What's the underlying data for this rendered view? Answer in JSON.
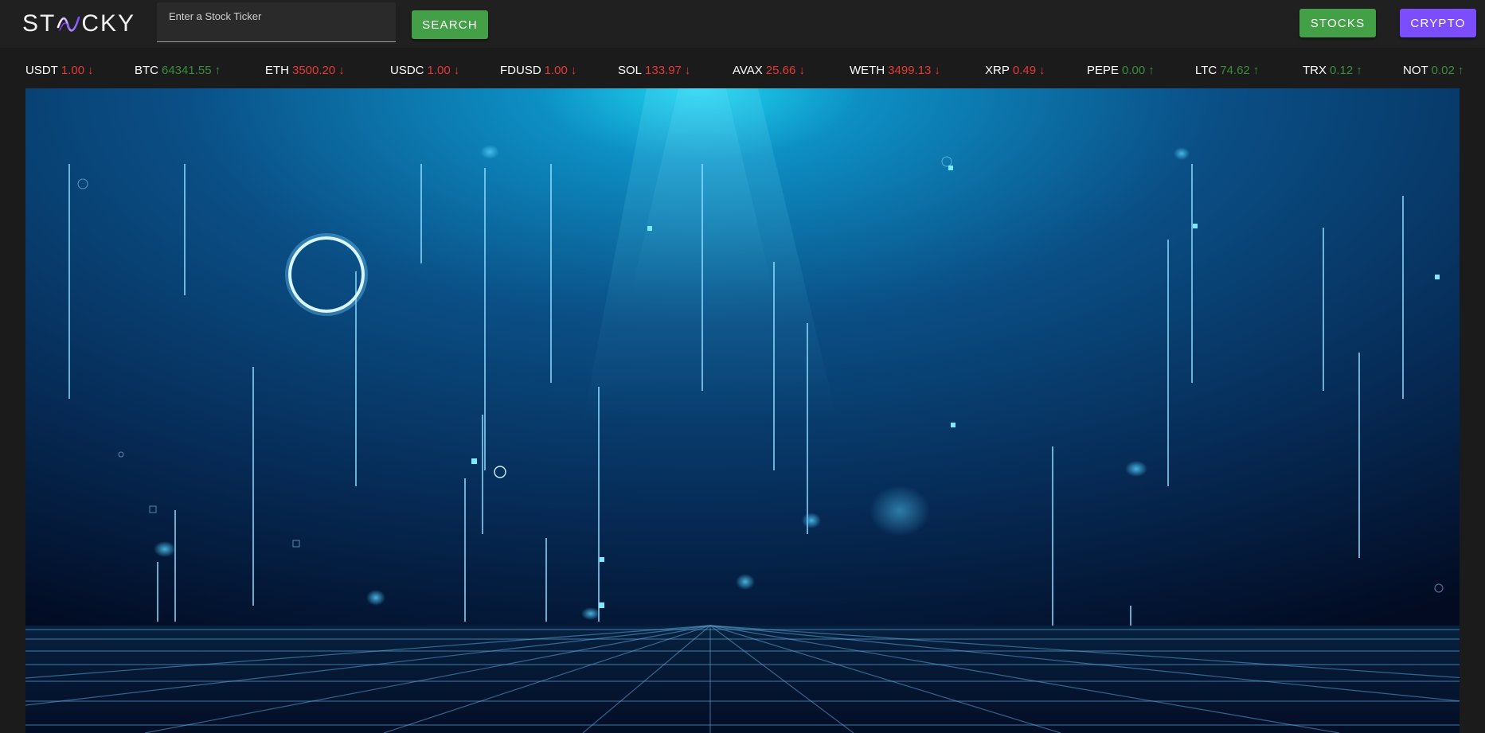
{
  "app": {
    "logo_left": "ST",
    "logo_right": "CKY"
  },
  "search": {
    "placeholder": "Enter a Stock Ticker",
    "value": "",
    "button_label": "SEARCH"
  },
  "nav": {
    "stocks_label": "STOCKS",
    "crypto_label": "CRYPTO"
  },
  "ticker": [
    {
      "symbol": "USDT",
      "price": "1.00",
      "direction": "down"
    },
    {
      "symbol": "BTC",
      "price": "64341.55",
      "direction": "up"
    },
    {
      "symbol": "ETH",
      "price": "3500.20",
      "direction": "down"
    },
    {
      "symbol": "USDC",
      "price": "1.00",
      "direction": "down"
    },
    {
      "symbol": "FDUSD",
      "price": "1.00",
      "direction": "down"
    },
    {
      "symbol": "SOL",
      "price": "133.97",
      "direction": "down"
    },
    {
      "symbol": "AVAX",
      "price": "25.66",
      "direction": "down"
    },
    {
      "symbol": "WETH",
      "price": "3499.13",
      "direction": "down"
    },
    {
      "symbol": "XRP",
      "price": "0.49",
      "direction": "down"
    },
    {
      "symbol": "PEPE",
      "price": "0.00",
      "direction": "up"
    },
    {
      "symbol": "LTC",
      "price": "74.62",
      "direction": "up"
    },
    {
      "symbol": "TRX",
      "price": "0.12",
      "direction": "up"
    },
    {
      "symbol": "NOT",
      "price": "0.02",
      "direction": "up"
    }
  ],
  "colors": {
    "up": "#388e3c",
    "down": "#e53935",
    "stocks_button": "#43a047",
    "crypto_button": "#7c4dff",
    "search_button": "#43a047"
  },
  "icons": {
    "up": "↑",
    "down": "↓"
  }
}
